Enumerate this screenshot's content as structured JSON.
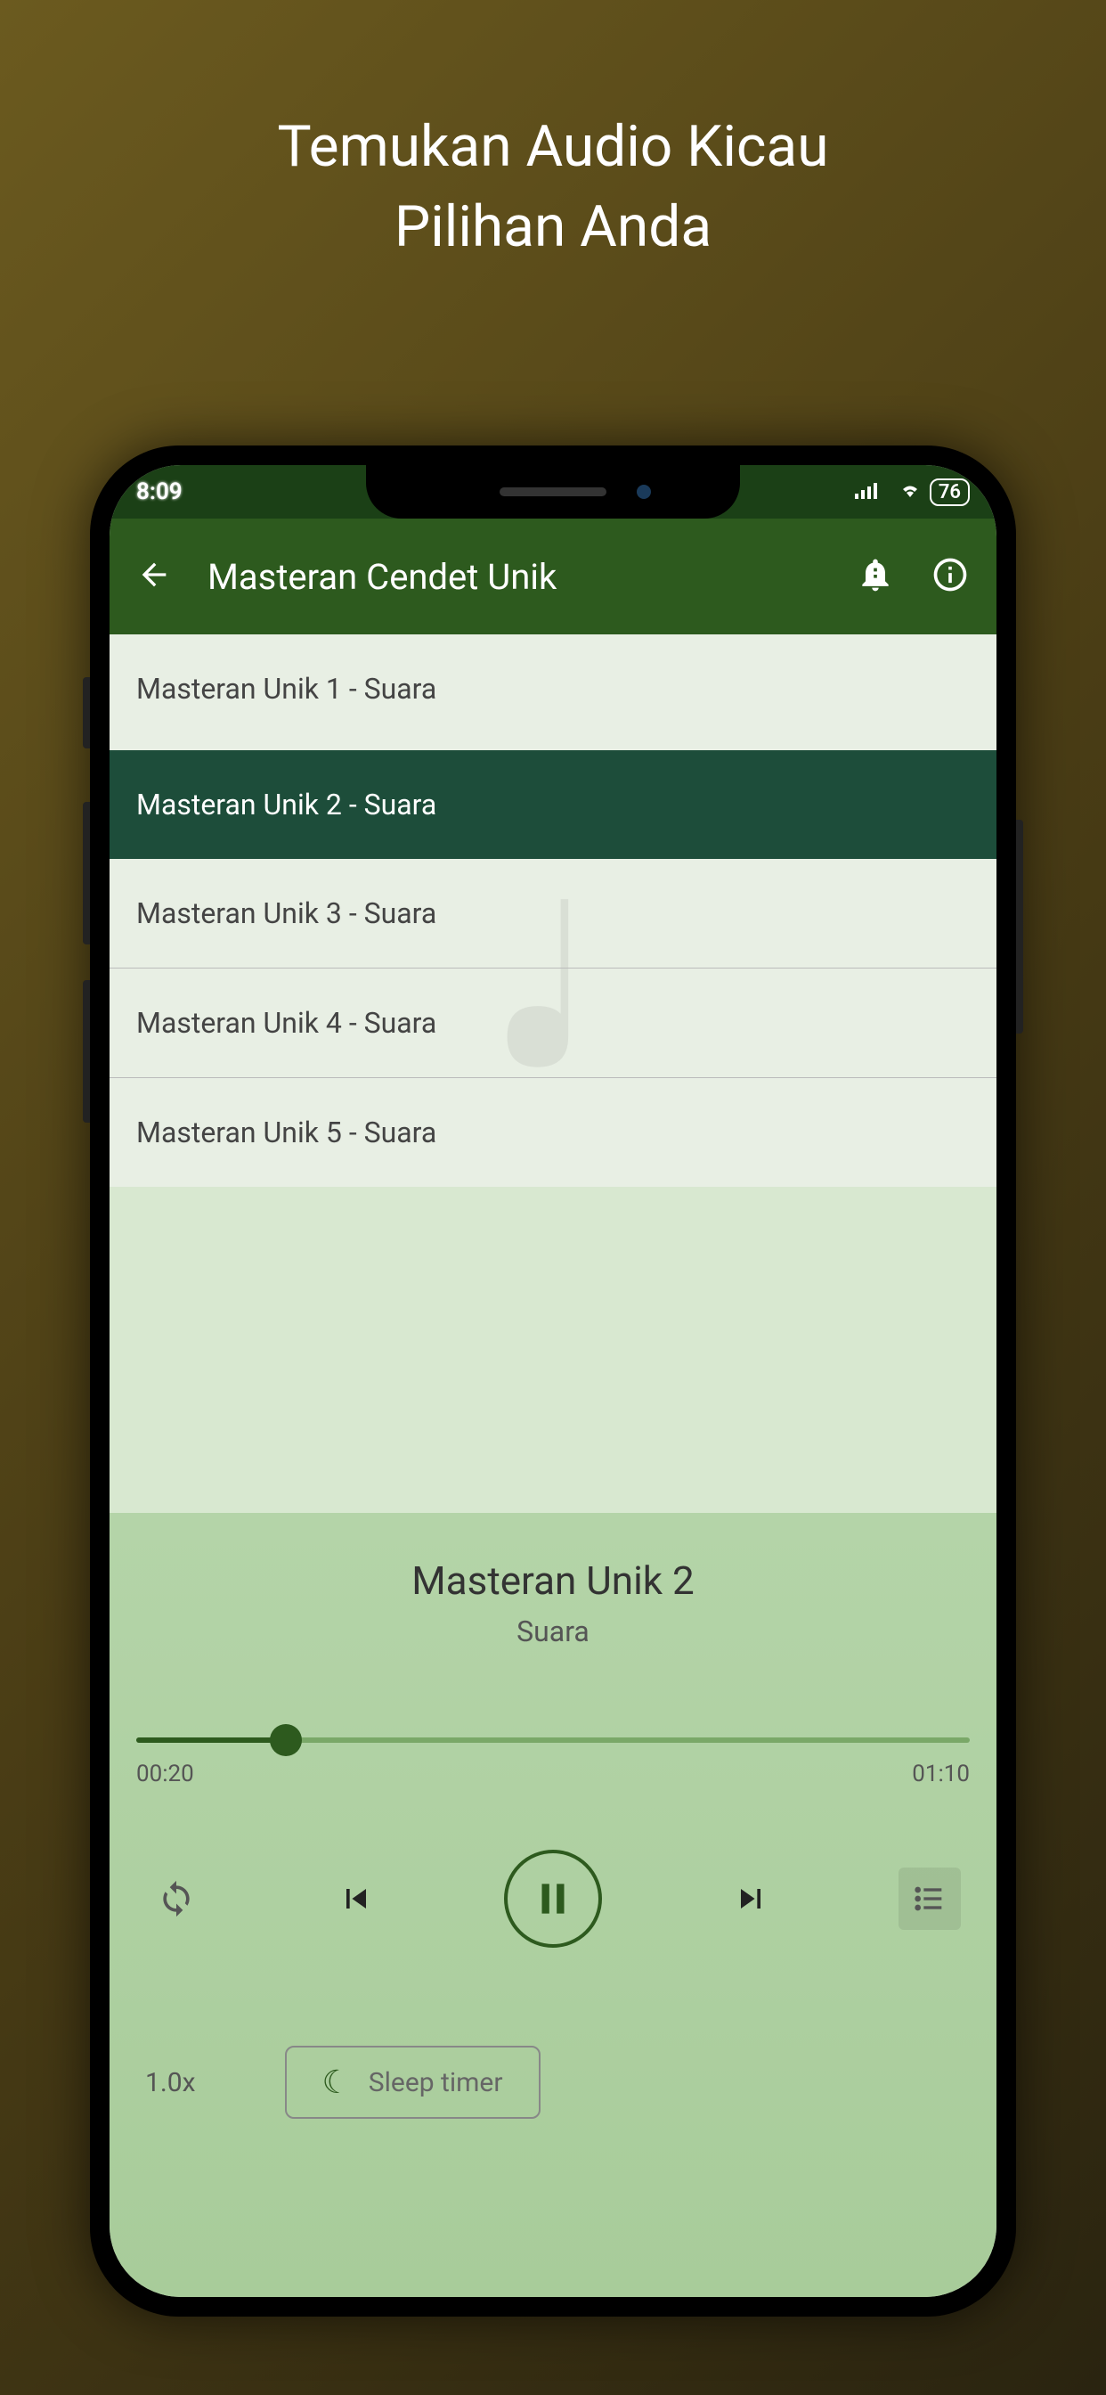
{
  "promo": {
    "line1": "Temukan Audio Kicau",
    "line2": "Pilihan Anda"
  },
  "status": {
    "time": "8:09",
    "battery": "76"
  },
  "appbar": {
    "title": "Masteran Cendet Unik"
  },
  "tracks": [
    {
      "label": "Masteran Unik 1 - Suara",
      "active": false
    },
    {
      "label": "Masteran Unik 2 - Suara",
      "active": true
    },
    {
      "label": "Masteran Unik 3 - Suara",
      "active": false
    },
    {
      "label": "Masteran Unik 4 - Suara",
      "active": false
    },
    {
      "label": "Masteran Unik 5 - Suara",
      "active": false
    }
  ],
  "player": {
    "title": "Masteran Unik 2",
    "subtitle": "Suara",
    "elapsed": "00:20",
    "total": "01:10",
    "progress_percent": 18,
    "speed": "1.0x",
    "sleep_timer_label": "Sleep timer"
  }
}
